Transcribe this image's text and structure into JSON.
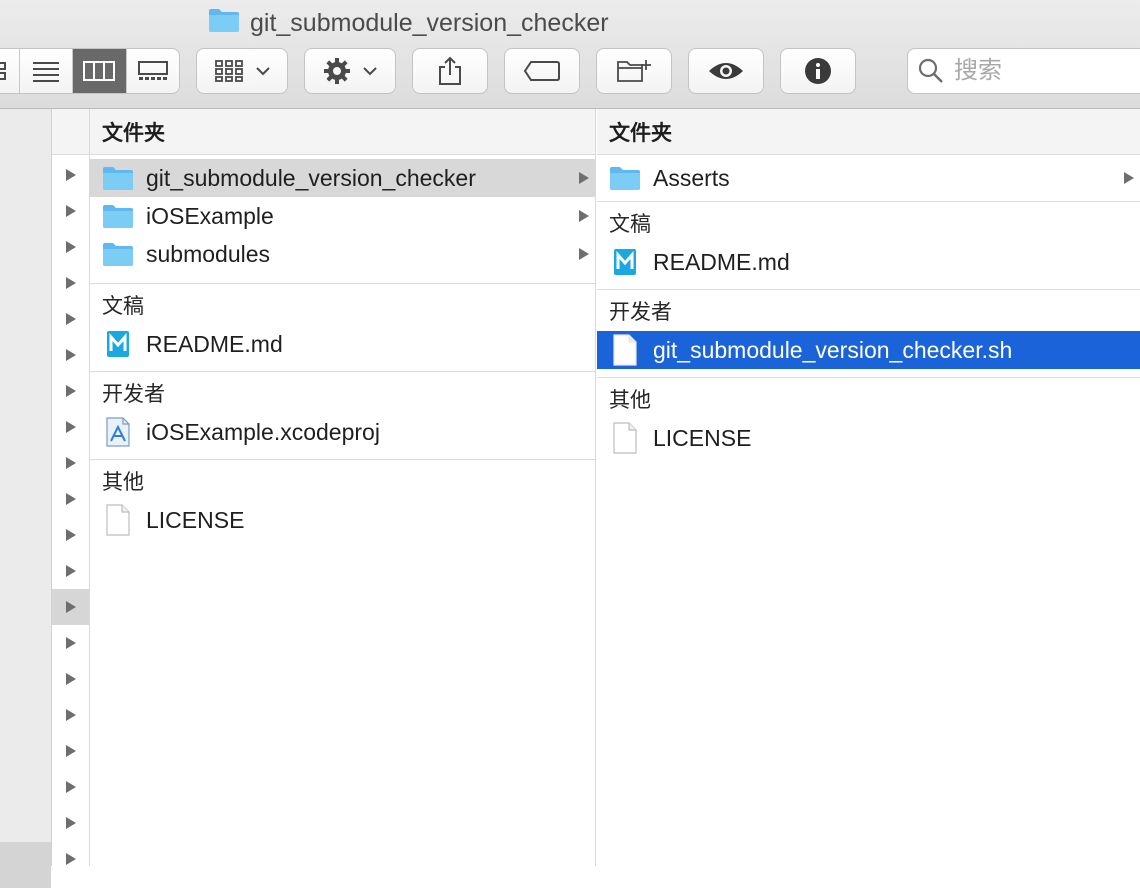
{
  "window": {
    "title": "git_submodule_version_checker"
  },
  "toolbar": {
    "view_modes": [
      "icon-view",
      "list-view",
      "column-view",
      "gallery-view"
    ],
    "active_view": "column-view",
    "buttons": [
      "group-by",
      "action-gear",
      "share",
      "tags",
      "new-folder",
      "quick-look",
      "get-info"
    ]
  },
  "search": {
    "placeholder": "搜索",
    "value": ""
  },
  "column1": {
    "header": "文件夹",
    "folders": [
      {
        "name": "git_submodule_version_checker",
        "has_children": true,
        "state": "highlighted"
      },
      {
        "name": "iOSExample",
        "has_children": true,
        "state": "normal"
      },
      {
        "name": "submodules",
        "has_children": true,
        "state": "normal"
      }
    ],
    "groups": [
      {
        "label": "文稿",
        "items": [
          {
            "name": "README.md",
            "icon": "markdown-icon"
          }
        ]
      },
      {
        "label": "开发者",
        "items": [
          {
            "name": "iOSExample.xcodeproj",
            "icon": "xcode-project-icon"
          }
        ]
      },
      {
        "label": "其他",
        "items": [
          {
            "name": "LICENSE",
            "icon": "blank-document-icon"
          }
        ]
      }
    ]
  },
  "column2": {
    "header": "文件夹",
    "folders": [
      {
        "name": "Asserts",
        "has_children": true
      }
    ],
    "groups": [
      {
        "label": "文稿",
        "items": [
          {
            "name": "README.md",
            "icon": "markdown-icon"
          }
        ]
      },
      {
        "label": "开发者",
        "items": [
          {
            "name": "git_submodule_version_checker.sh",
            "icon": "shell-script-icon",
            "selected": true
          }
        ]
      },
      {
        "label": "其他",
        "items": [
          {
            "name": "LICENSE",
            "icon": "blank-document-icon"
          }
        ]
      }
    ]
  },
  "colors": {
    "selection": "#1a63d8",
    "folder": "#6cc3f3",
    "highlight": "#d8d8d8"
  }
}
